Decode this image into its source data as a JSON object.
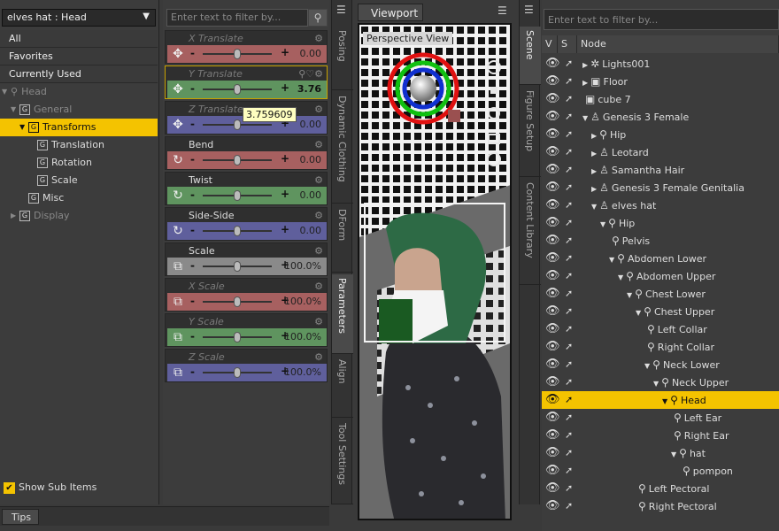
{
  "left": {
    "node_select": "elves hat : Head",
    "categories": [
      "All",
      "Favorites",
      "Currently Used"
    ],
    "tree": [
      {
        "label": "Head",
        "level": 0,
        "expanded": true,
        "icon": "bone-icon",
        "dim": true
      },
      {
        "label": "General",
        "level": 1,
        "expanded": true,
        "icon": "G",
        "dim": true
      },
      {
        "label": "Transforms",
        "level": 2,
        "expanded": true,
        "icon": "G",
        "selected": true
      },
      {
        "label": "Translation",
        "level": 3,
        "icon": "G"
      },
      {
        "label": "Rotation",
        "level": 3,
        "icon": "G"
      },
      {
        "label": "Scale",
        "level": 3,
        "icon": "G"
      },
      {
        "label": "Misc",
        "level": 2,
        "icon": "G"
      },
      {
        "label": "Display",
        "level": 1,
        "expanded": false,
        "icon": "G",
        "dim": true
      }
    ],
    "show_sub_items": "Show Sub Items"
  },
  "params": {
    "filter_placeholder": "Enter text to filter by...",
    "items": [
      {
        "label": "X Translate",
        "value": "0.00",
        "color": "#a76060",
        "icon": "move-icon",
        "dim": true,
        "knob": 0.5
      },
      {
        "label": "Y Translate",
        "value": "3.76",
        "color": "#5f945f",
        "icon": "move-icon",
        "dim": true,
        "knob": 0.5,
        "highlight": true
      },
      {
        "label": "Z Translate",
        "value": "0.00",
        "color": "#5f5f9c",
        "icon": "move-icon",
        "dim": true,
        "knob": 0.5
      },
      {
        "label": "Bend",
        "value": "0.00",
        "color": "#a76060",
        "icon": "rotate-icon",
        "knob": 0.5
      },
      {
        "label": "Twist",
        "value": "0.00",
        "color": "#5f945f",
        "icon": "rotate-icon",
        "knob": 0.5
      },
      {
        "label": "Side-Side",
        "value": "0.00",
        "color": "#5f5f9c",
        "icon": "rotate-icon",
        "knob": 0.5
      },
      {
        "label": "Scale",
        "value": "100.0%",
        "color": "#8a8a8a",
        "icon": "scale-icon",
        "knob": 0.5
      },
      {
        "label": "X Scale",
        "value": "100.0%",
        "color": "#a76060",
        "icon": "scale-icon",
        "dim": true,
        "knob": 0.5
      },
      {
        "label": "Y Scale",
        "value": "100.0%",
        "color": "#5f945f",
        "icon": "scale-icon",
        "dim": true,
        "knob": 0.5
      },
      {
        "label": "Z Scale",
        "value": "100.0%",
        "color": "#5f5f9c",
        "icon": "scale-icon",
        "dim": true,
        "knob": 0.5
      }
    ],
    "tooltip": "3.759609"
  },
  "tabs_mid": [
    "Posing",
    "Dynamic Clothing",
    "DForm",
    "Parameters",
    "Align",
    "Tool Settings"
  ],
  "viewport": {
    "title": "Viewport",
    "camera": "Perspective View"
  },
  "tabs_right": [
    "Scene",
    "Figure Setup",
    "Content Library"
  ],
  "scene": {
    "filter_placeholder": "Enter text to filter by...",
    "headers": {
      "v": "V",
      "s": "S",
      "node": "Node"
    },
    "rows": [
      {
        "label": "Lights001",
        "level": 0,
        "tri": "▶",
        "icon": "lights-icon"
      },
      {
        "label": "Floor",
        "level": 0,
        "tri": "▶",
        "icon": "cube-icon"
      },
      {
        "label": "cube 7",
        "level": 0,
        "tri": "",
        "icon": "cube-icon"
      },
      {
        "label": "Genesis 3 Female",
        "level": 0,
        "tri": "▼",
        "icon": "figure-icon"
      },
      {
        "label": "Hip",
        "level": 1,
        "tri": "▶",
        "icon": "bone-icon"
      },
      {
        "label": "Leotard",
        "level": 1,
        "tri": "▶",
        "icon": "figure-icon"
      },
      {
        "label": "Samantha Hair",
        "level": 1,
        "tri": "▶",
        "icon": "figure-icon"
      },
      {
        "label": "Genesis 3 Female Genitalia",
        "level": 1,
        "tri": "▶",
        "icon": "figure-icon"
      },
      {
        "label": "elves hat",
        "level": 1,
        "tri": "▼",
        "icon": "figure-icon"
      },
      {
        "label": "Hip",
        "level": 2,
        "tri": "▼",
        "icon": "bone-icon"
      },
      {
        "label": "Pelvis",
        "level": 3,
        "tri": "",
        "icon": "bone-icon"
      },
      {
        "label": "Abdomen Lower",
        "level": 3,
        "tri": "▼",
        "icon": "bone-icon"
      },
      {
        "label": "Abdomen Upper",
        "level": 4,
        "tri": "▼",
        "icon": "bone-icon"
      },
      {
        "label": "Chest Lower",
        "level": 5,
        "tri": "▼",
        "icon": "bone-icon"
      },
      {
        "label": "Chest Upper",
        "level": 6,
        "tri": "▼",
        "icon": "bone-icon"
      },
      {
        "label": "Left Collar",
        "level": 7,
        "tri": "",
        "icon": "bone-icon"
      },
      {
        "label": "Right Collar",
        "level": 7,
        "tri": "",
        "icon": "bone-icon"
      },
      {
        "label": "Neck Lower",
        "level": 7,
        "tri": "▼",
        "icon": "bone-icon"
      },
      {
        "label": "Neck Upper",
        "level": 8,
        "tri": "▼",
        "icon": "bone-icon"
      },
      {
        "label": "Head",
        "level": 9,
        "tri": "▼",
        "icon": "bone-icon",
        "selected": true
      },
      {
        "label": "Left Ear",
        "level": 10,
        "tri": "",
        "icon": "bone-icon"
      },
      {
        "label": "Right Ear",
        "level": 10,
        "tri": "",
        "icon": "bone-icon"
      },
      {
        "label": "hat",
        "level": 10,
        "tri": "▼",
        "icon": "bone-icon"
      },
      {
        "label": "pompon",
        "level": 11,
        "tri": "",
        "icon": "bone-icon"
      },
      {
        "label": "Left Pectoral",
        "level": 6,
        "tri": "",
        "icon": "bone-icon"
      },
      {
        "label": "Right Pectoral",
        "level": 6,
        "tri": "",
        "icon": "bone-icon"
      }
    ]
  },
  "bottom": {
    "tips": "Tips"
  }
}
